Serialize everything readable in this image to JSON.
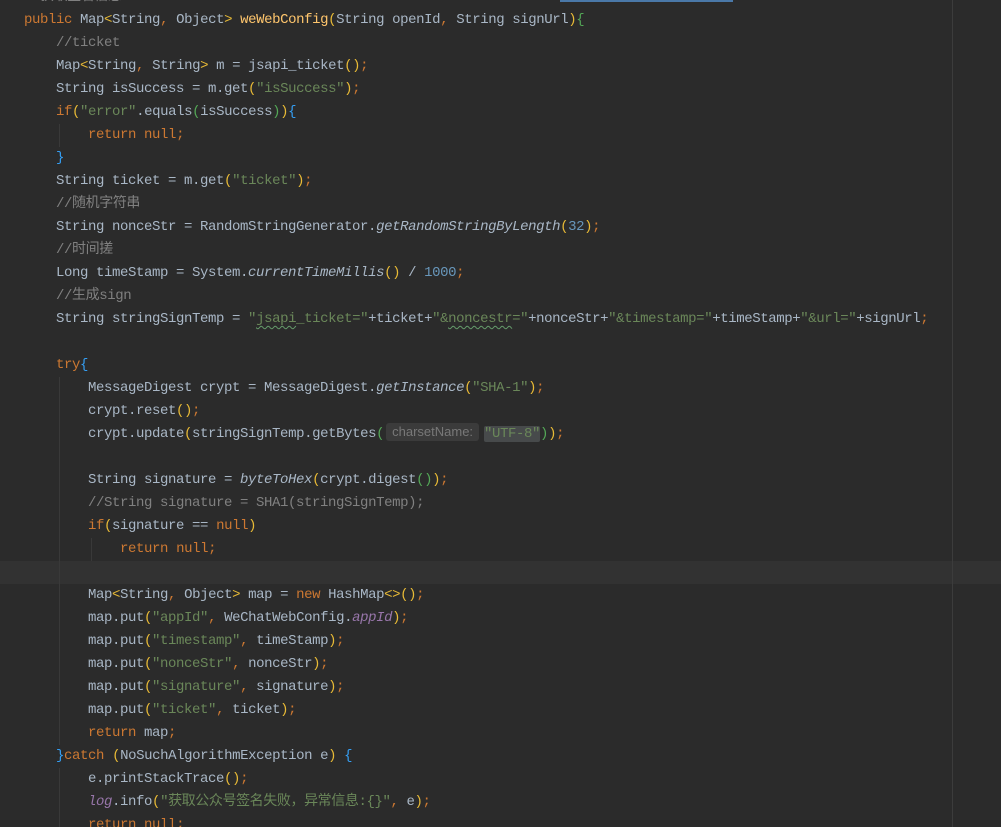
{
  "editor": {
    "colors": {
      "bg": "#2B2B2B",
      "caret_row": "#323232",
      "guide": "#393939",
      "margin": "#3C3C3C",
      "top_accent": "#4A78A8",
      "pl": "#A9B7C6",
      "kw": "#CC7832",
      "punc": "#CC7832",
      "str": "#6A8759",
      "cm": "#808080",
      "num": "#6897BB",
      "decl": "#FFC66D",
      "smeth": "#A9B7C6",
      "sfield": "#9876AA",
      "br1": "#E8BA36",
      "br2": "#54A857",
      "br3": "#359FF4",
      "typo": "#659C6B",
      "hint": "#787878",
      "hint_bg": "#3B3B3B",
      "strsel_bg": "#474A4B"
    },
    "caret_line": 25,
    "lines": [
      {
        "tokens": [
          {
            "cm": "//获取签名信息"
          }
        ]
      },
      {
        "tokens": [
          {
            "kw": "public"
          },
          {
            "pl": " Map"
          },
          {
            "br1": "<"
          },
          {
            "pl": "String"
          },
          {
            "punc": ","
          },
          {
            "pl": " Object"
          },
          {
            "br1": ">"
          },
          {
            "pl": " "
          },
          {
            "decl": "weWebConfig"
          },
          {
            "br1": "("
          },
          {
            "pl": "String openId"
          },
          {
            "punc": ","
          },
          {
            "pl": " String signUrl"
          },
          {
            "br1": ")"
          },
          {
            "br2": "{"
          }
        ]
      },
      {
        "tokens": [
          {
            "pl": "    "
          },
          {
            "cm": "//ticket"
          }
        ]
      },
      {
        "tokens": [
          {
            "pl": "    Map"
          },
          {
            "br1": "<"
          },
          {
            "pl": "String"
          },
          {
            "punc": ","
          },
          {
            "pl": " String"
          },
          {
            "br1": ">"
          },
          {
            "pl": " m = jsapi_ticket"
          },
          {
            "br1": "()"
          },
          {
            "punc": ";"
          }
        ]
      },
      {
        "tokens": [
          {
            "pl": "    String isSuccess = m.get"
          },
          {
            "br1": "("
          },
          {
            "str": "\"isSuccess\""
          },
          {
            "br1": ")"
          },
          {
            "punc": ";"
          }
        ]
      },
      {
        "tokens": [
          {
            "pl": "    "
          },
          {
            "kw": "if"
          },
          {
            "br1": "("
          },
          {
            "str": "\"error\""
          },
          {
            "pl": ".equals"
          },
          {
            "br2": "("
          },
          {
            "pl": "isSuccess"
          },
          {
            "br2": ")"
          },
          {
            "br1": ")"
          },
          {
            "br3": "{"
          }
        ]
      },
      {
        "tokens": [
          {
            "pl": "        "
          },
          {
            "kw": "return"
          },
          {
            "pl": " "
          },
          {
            "kw": "null"
          },
          {
            "punc": ";"
          }
        ]
      },
      {
        "tokens": [
          {
            "pl": "    "
          },
          {
            "br3": "}"
          }
        ]
      },
      {
        "tokens": [
          {
            "pl": "    String ticket = m.get"
          },
          {
            "br1": "("
          },
          {
            "str": "\"ticket\""
          },
          {
            "br1": ")"
          },
          {
            "punc": ";"
          }
        ]
      },
      {
        "tokens": [
          {
            "pl": "    "
          },
          {
            "cm": "//随机字符串"
          }
        ]
      },
      {
        "tokens": [
          {
            "pl": "    String nonceStr = RandomStringGenerator."
          },
          {
            "smeth": "getRandomStringByLength"
          },
          {
            "br1": "("
          },
          {
            "num": "32"
          },
          {
            "br1": ")"
          },
          {
            "punc": ";"
          }
        ]
      },
      {
        "tokens": [
          {
            "pl": "    "
          },
          {
            "cm": "//时间搓"
          }
        ]
      },
      {
        "tokens": [
          {
            "pl": "    Long timeStamp = System."
          },
          {
            "smeth": "currentTimeMillis"
          },
          {
            "br1": "()"
          },
          {
            "pl": " / "
          },
          {
            "num": "1000"
          },
          {
            "punc": ";"
          }
        ]
      },
      {
        "tokens": [
          {
            "pl": "    "
          },
          {
            "cm": "//生成sign"
          }
        ]
      },
      {
        "tokens": [
          {
            "pl": "    String stringSignTemp = "
          },
          {
            "str": "\""
          },
          {
            "typo": "jsapi"
          },
          {
            "str": "_ticket=\""
          },
          {
            "pl": "+ticket+"
          },
          {
            "str": "\"&"
          },
          {
            "typo": "noncestr"
          },
          {
            "str": "=\""
          },
          {
            "pl": "+nonceStr+"
          },
          {
            "str": "\"&timestamp=\""
          },
          {
            "pl": "+timeStamp+"
          },
          {
            "str": "\"&url=\""
          },
          {
            "pl": "+signUrl"
          },
          {
            "punc": ";"
          }
        ]
      },
      {
        "tokens": []
      },
      {
        "tokens": [
          {
            "pl": "    "
          },
          {
            "kw": "try"
          },
          {
            "br3": "{"
          }
        ]
      },
      {
        "tokens": [
          {
            "pl": "        MessageDigest crypt = MessageDigest."
          },
          {
            "smeth": "getInstance"
          },
          {
            "br1": "("
          },
          {
            "str": "\"SHA-1\""
          },
          {
            "br1": ")"
          },
          {
            "punc": ";"
          }
        ]
      },
      {
        "tokens": [
          {
            "pl": "        crypt.reset"
          },
          {
            "br1": "()"
          },
          {
            "punc": ";"
          }
        ]
      },
      {
        "tokens": [
          {
            "pl": "        crypt.update"
          },
          {
            "br1": "("
          },
          {
            "pl": "stringSignTemp.getBytes"
          },
          {
            "br2": "("
          },
          {
            "hint": "charsetName:"
          },
          {
            "strsel": "\"UTF-8\""
          },
          {
            "br2": ")"
          },
          {
            "br1": ")"
          },
          {
            "punc": ";"
          }
        ]
      },
      {
        "tokens": []
      },
      {
        "tokens": [
          {
            "pl": "        String signature = "
          },
          {
            "smeth": "byteToHex"
          },
          {
            "br1": "("
          },
          {
            "pl": "crypt.digest"
          },
          {
            "br2": "()"
          },
          {
            "br1": ")"
          },
          {
            "punc": ";"
          }
        ]
      },
      {
        "tokens": [
          {
            "pl": "        "
          },
          {
            "cm": "//String signature = SHA1(stringSignTemp);"
          }
        ]
      },
      {
        "tokens": [
          {
            "pl": "        "
          },
          {
            "kw": "if"
          },
          {
            "br1": "("
          },
          {
            "pl": "signature == "
          },
          {
            "kw": "null"
          },
          {
            "br1": ")"
          }
        ]
      },
      {
        "tokens": [
          {
            "pl": "            "
          },
          {
            "kw": "return"
          },
          {
            "pl": " "
          },
          {
            "kw": "null"
          },
          {
            "punc": ";"
          }
        ]
      },
      {
        "tokens": []
      },
      {
        "tokens": [
          {
            "pl": "        Map"
          },
          {
            "br1": "<"
          },
          {
            "pl": "String"
          },
          {
            "punc": ","
          },
          {
            "pl": " Object"
          },
          {
            "br1": ">"
          },
          {
            "pl": " map = "
          },
          {
            "kw": "new"
          },
          {
            "pl": " HashMap"
          },
          {
            "br1": "<>"
          },
          {
            "br1": "()"
          },
          {
            "punc": ";"
          }
        ]
      },
      {
        "tokens": [
          {
            "pl": "        map.put"
          },
          {
            "br1": "("
          },
          {
            "str": "\"appId\""
          },
          {
            "punc": ","
          },
          {
            "pl": " WeChatWebConfig."
          },
          {
            "sfield": "appId"
          },
          {
            "br1": ")"
          },
          {
            "punc": ";"
          }
        ]
      },
      {
        "tokens": [
          {
            "pl": "        map.put"
          },
          {
            "br1": "("
          },
          {
            "str": "\"timestamp\""
          },
          {
            "punc": ","
          },
          {
            "pl": " timeStamp"
          },
          {
            "br1": ")"
          },
          {
            "punc": ";"
          }
        ]
      },
      {
        "tokens": [
          {
            "pl": "        map.put"
          },
          {
            "br1": "("
          },
          {
            "str": "\"nonceStr\""
          },
          {
            "punc": ","
          },
          {
            "pl": " nonceStr"
          },
          {
            "br1": ")"
          },
          {
            "punc": ";"
          }
        ]
      },
      {
        "tokens": [
          {
            "pl": "        map.put"
          },
          {
            "br1": "("
          },
          {
            "str": "\"signature\""
          },
          {
            "punc": ","
          },
          {
            "pl": " signature"
          },
          {
            "br1": ")"
          },
          {
            "punc": ";"
          }
        ]
      },
      {
        "tokens": [
          {
            "pl": "        map.put"
          },
          {
            "br1": "("
          },
          {
            "str": "\"ticket\""
          },
          {
            "punc": ","
          },
          {
            "pl": " ticket"
          },
          {
            "br1": ")"
          },
          {
            "punc": ";"
          }
        ]
      },
      {
        "tokens": [
          {
            "pl": "        "
          },
          {
            "kw": "return"
          },
          {
            "pl": " map"
          },
          {
            "punc": ";"
          }
        ]
      },
      {
        "tokens": [
          {
            "pl": "    "
          },
          {
            "br3": "}"
          },
          {
            "kw": "catch"
          },
          {
            "pl": " "
          },
          {
            "br1": "("
          },
          {
            "pl": "NoSuchAlgorithmException e"
          },
          {
            "br1": ")"
          },
          {
            "pl": " "
          },
          {
            "br3": "{"
          }
        ]
      },
      {
        "tokens": [
          {
            "pl": "        e.printStackTrace"
          },
          {
            "br1": "()"
          },
          {
            "punc": ";"
          }
        ]
      },
      {
        "tokens": [
          {
            "pl": "        "
          },
          {
            "sfield": "log"
          },
          {
            "pl": ".info"
          },
          {
            "br1": "("
          },
          {
            "str": "\"获取公众号签名失败，异常信息:{}\""
          },
          {
            "punc": ","
          },
          {
            "pl": " e"
          },
          {
            "br1": ")"
          },
          {
            "punc": ";"
          }
        ]
      },
      {
        "tokens": [
          {
            "pl": "        "
          },
          {
            "kw": "return"
          },
          {
            "pl": " "
          },
          {
            "kw": "null"
          },
          {
            "punc": ";"
          }
        ]
      }
    ]
  }
}
